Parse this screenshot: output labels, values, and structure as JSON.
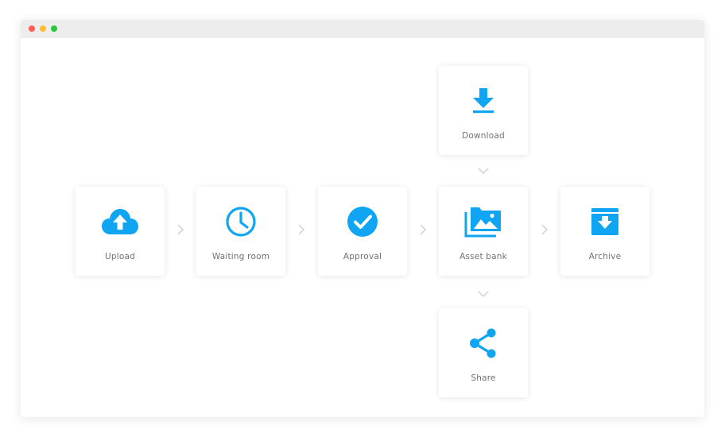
{
  "window": {
    "controls": [
      "close",
      "minimize",
      "maximize"
    ]
  },
  "accent_color": "#0fa5f2",
  "arrow_color": "#c9cdd1",
  "workflow": {
    "upload": {
      "label": "Upload",
      "icon": "cloud-upload-icon"
    },
    "waiting": {
      "label": "Waiting room",
      "icon": "clock-icon"
    },
    "approval": {
      "label": "Approval",
      "icon": "check-circle-icon"
    },
    "asset": {
      "label": "Asset bank",
      "icon": "photo-folder-icon"
    },
    "archive": {
      "label": "Archive",
      "icon": "archive-box-icon"
    },
    "download": {
      "label": "Download",
      "icon": "download-icon"
    },
    "share": {
      "label": "Share",
      "icon": "share-icon"
    }
  }
}
